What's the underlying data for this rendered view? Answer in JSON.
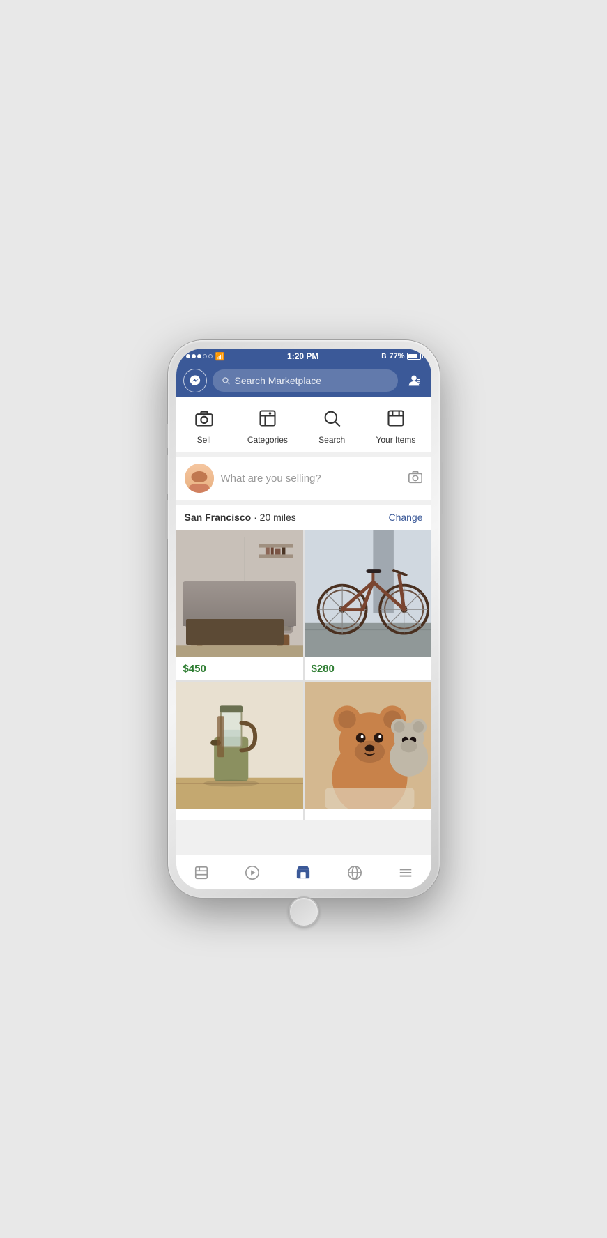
{
  "phone": {
    "status_bar": {
      "time": "1:20 PM",
      "battery_percent": "77%",
      "signal_dots": [
        true,
        true,
        true,
        false,
        false
      ]
    },
    "nav_bar": {
      "search_placeholder": "Search Marketplace",
      "messenger_icon": "messenger-icon",
      "profile_icon": "profile-menu-icon"
    },
    "quick_actions": [
      {
        "id": "sell",
        "icon": "camera-icon",
        "label": "Sell"
      },
      {
        "id": "categories",
        "icon": "categories-icon",
        "label": "Categories"
      },
      {
        "id": "search",
        "icon": "search-icon",
        "label": "Search"
      },
      {
        "id": "your-items",
        "icon": "your-items-icon",
        "label": "Your Items"
      }
    ],
    "sell_bar": {
      "placeholder": "What are you selling?",
      "camera_icon": "camera-small-icon"
    },
    "location": {
      "city": "San Francisco",
      "miles": "20 miles",
      "change_label": "Change"
    },
    "products": [
      {
        "id": "sofa",
        "price": "$450",
        "type": "sofa"
      },
      {
        "id": "bike",
        "price": "$280",
        "type": "bike"
      },
      {
        "id": "coffee",
        "price": "",
        "type": "coffee"
      },
      {
        "id": "bears",
        "price": "",
        "type": "bears"
      }
    ],
    "bottom_tabs": [
      {
        "id": "newsfeed",
        "icon": "newsfeed-icon",
        "active": false
      },
      {
        "id": "video",
        "icon": "video-icon",
        "active": false
      },
      {
        "id": "marketplace",
        "icon": "marketplace-icon",
        "active": true
      },
      {
        "id": "globe",
        "icon": "globe-icon",
        "active": false
      },
      {
        "id": "menu",
        "icon": "menu-icon",
        "active": false
      }
    ]
  },
  "colors": {
    "facebook_blue": "#3b5998",
    "price_green": "#2e7d32",
    "change_blue": "#3b5998"
  }
}
